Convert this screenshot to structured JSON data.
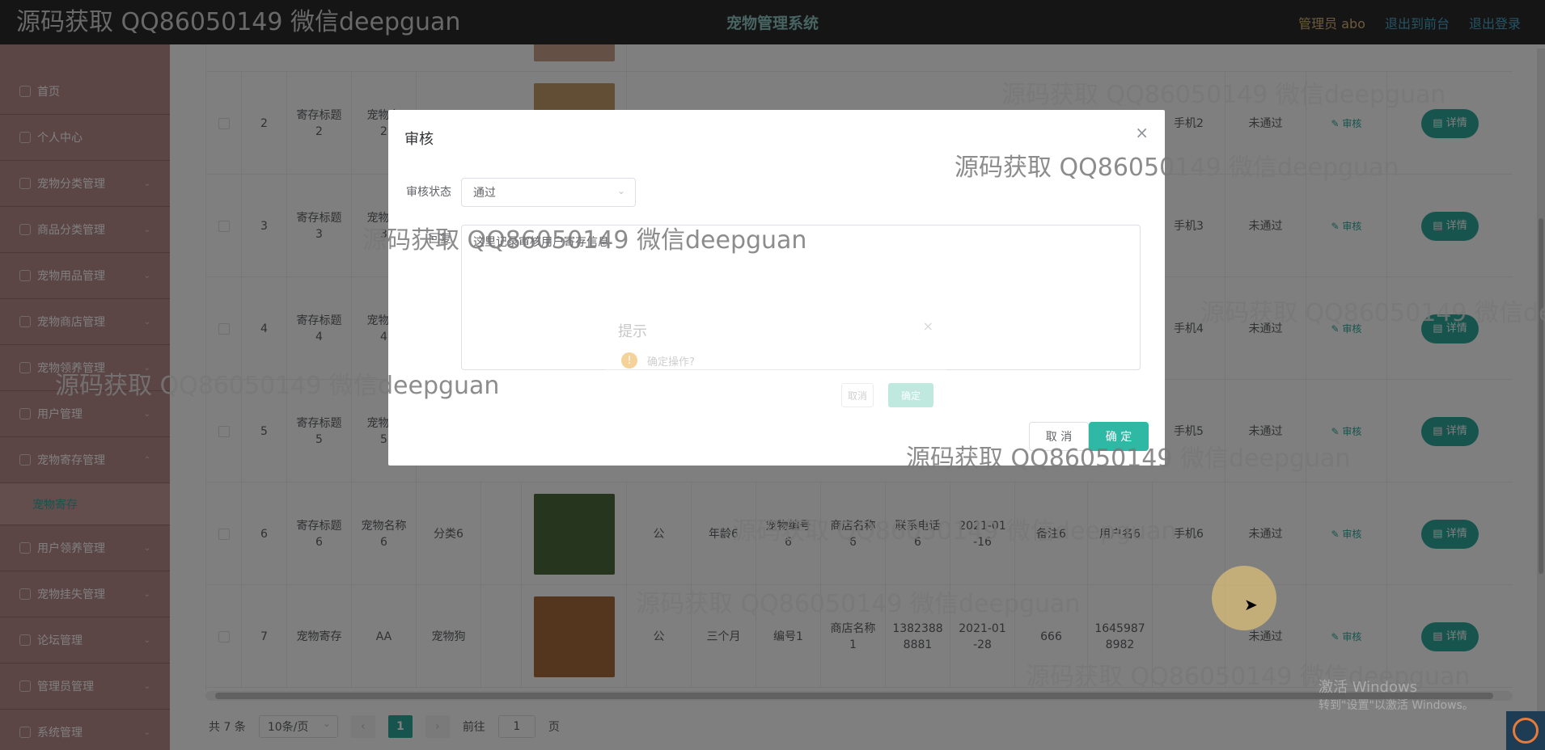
{
  "header": {
    "title": "宠物管理系统",
    "admin": "管理员 abo",
    "links": [
      "退出到前台",
      "退出登录"
    ]
  },
  "sidebar": {
    "items": [
      "首页",
      "个人中心",
      "宠物分类管理",
      "商品分类管理",
      "宠物用品管理",
      "宠物商店管理",
      "宠物领养管理",
      "用户管理",
      "宠物寄存管理"
    ],
    "active_sub": "宠物寄存",
    "items_after": [
      "用户领养管理",
      "宠物挂失管理",
      "论坛管理",
      "管理员管理",
      "系统管理"
    ]
  },
  "table": {
    "rows": [
      {
        "idx": "2",
        "title": "寄存标题\n2",
        "pet": "宠物名\n2",
        "status": "未通过",
        "phone": "手机2",
        "audit": "审核",
        "detail": "详情"
      },
      {
        "idx": "3",
        "title": "寄存标题\n3",
        "pet": "宠物名\n3",
        "status": "未通过",
        "phone": "手机3",
        "audit": "审核",
        "detail": "详情"
      },
      {
        "idx": "4",
        "title": "寄存标题\n4",
        "pet": "宠物名\n4",
        "status": "未通过",
        "phone": "手机4",
        "audit": "审核",
        "detail": "详情"
      },
      {
        "idx": "5",
        "title": "寄存标题\n5",
        "pet": "宠物名\n5",
        "status": "未通过",
        "phone": "手机5",
        "audit": "审核",
        "detail": "详情"
      },
      {
        "idx": "6",
        "title": "寄存标题\n6",
        "pet": "宠物名称\n6",
        "cat": "分类6",
        "gender": "公",
        "age": "年龄6",
        "code": "宠物编号\n6",
        "shop": "商店名称\n6",
        "tel": "联系电话\n6",
        "date": "2021-01\n-16",
        "remark": "备注6",
        "user": "用户名6",
        "phone": "手机6",
        "status": "未通过",
        "audit": "审核",
        "detail": "详情"
      },
      {
        "idx": "7",
        "title": "宠物寄存",
        "pet": "AA",
        "cat": "宠物狗",
        "gender": "公",
        "age": "三个月",
        "code": "编号1",
        "shop": "商店名称\n1",
        "tel": "1382388\n8881",
        "date": "2021-01\n-28",
        "remark": "666",
        "user": "1645987\n8982",
        "phone": "",
        "status": "未通过",
        "audit": "审核",
        "detail": "详情"
      }
    ]
  },
  "pagination": {
    "total": "共 7 条",
    "page_size": "10条/页",
    "current": "1",
    "goto_label": "前往",
    "goto_value": "1",
    "page_suffix": "页"
  },
  "dialog": {
    "title": "审核",
    "status_label": "审核状态",
    "status_value": "通过",
    "reply_label": "回复",
    "reply_value": "这里记录审核用户寄存信息",
    "cancel": "取 消",
    "ok": "确 定"
  },
  "message_box": {
    "title": "提示",
    "text": "确定操作?",
    "cancel": "取消",
    "ok": "确定"
  },
  "watermark": "源码获取 QQ86050149 微信deepguan",
  "windows_activation": {
    "line1": "激活 Windows",
    "line2": "转到\"设置\"以激活 Windows。"
  },
  "colors": {
    "accent": "#2fa89c",
    "sidebar": "#b98a8a",
    "topbar": "#2b2b2b"
  }
}
